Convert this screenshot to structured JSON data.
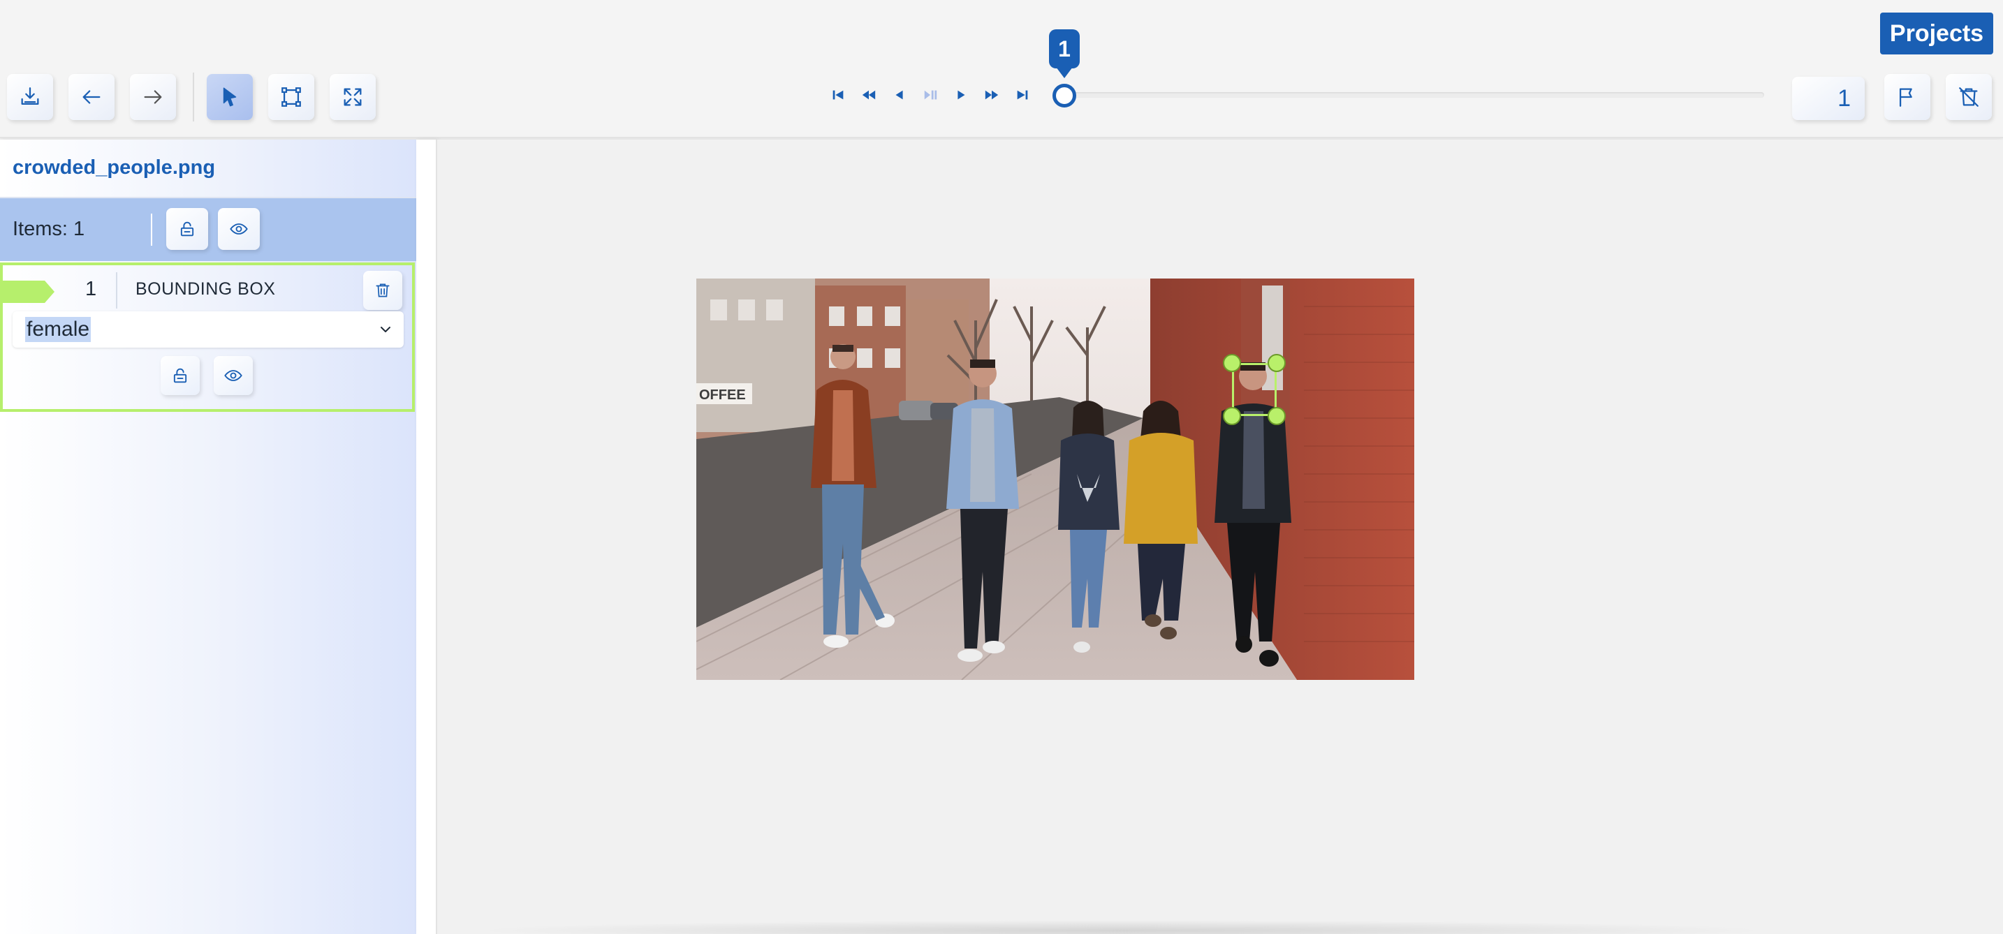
{
  "toolbar": {
    "buttons": [
      {
        "name": "download-annotations-icon"
      },
      {
        "name": "undo-arrow-icon"
      },
      {
        "name": "redo-arrow-icon"
      },
      {
        "name": "select-pointer-icon",
        "active": true
      },
      {
        "name": "bounding-box-tool-icon"
      },
      {
        "name": "fit-screen-icon"
      }
    ]
  },
  "player": {
    "controls": [
      "skip-to-start-icon",
      "rewind-icon",
      "step-back-icon",
      "play-pause-icon",
      "step-forward-icon",
      "fast-forward-icon",
      "skip-to-end-icon"
    ],
    "slider_bubble": "1",
    "slider_position": 0,
    "frame_value": "1"
  },
  "header": {
    "projects_label": "Projects"
  },
  "sidebar": {
    "filename": "crowded_people.png",
    "items_count": "Items: 1",
    "items": [
      {
        "number": "1",
        "type": "BOUNDING BOX",
        "label": "female",
        "color": "#b6ef6c"
      }
    ]
  },
  "colors": {
    "accent": "#1a5fb4",
    "items_bar": "#aac4ee",
    "annotation": "#b9f06a"
  }
}
